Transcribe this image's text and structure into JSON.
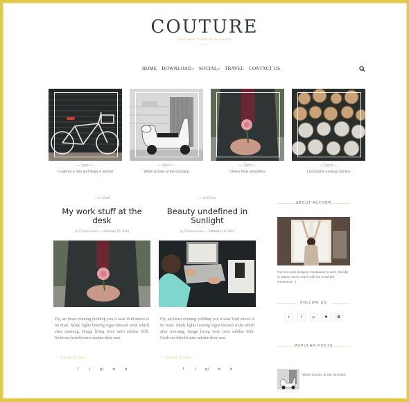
{
  "brand": {
    "logo": "COUTURE",
    "tagline": "FEATURED THEME BY BLOGGER",
    "frame_color": "#e2c84a",
    "accent_color": "#d9b76a"
  },
  "nav": {
    "items": [
      {
        "label": "HOME",
        "has_dropdown": false
      },
      {
        "label": "DOWNLOAD",
        "has_dropdown": true
      },
      {
        "label": "SOCIAL",
        "has_dropdown": true
      },
      {
        "label": "TRAVEL",
        "has_dropdown": false
      },
      {
        "label": "CONTACT US",
        "has_dropdown": false
      }
    ],
    "dropdown_glyph": "▾",
    "search_icon": "search-icon"
  },
  "featured": [
    {
      "category": "— Sport —",
      "title": "I ordered a dish and finally it arrived",
      "image": "bicycle-photo"
    },
    {
      "category": "— Sport —",
      "title": "White scooter at the doorstep",
      "image": "scooter-photo"
    },
    {
      "category": "— Sport —",
      "title": "Cherry fruits smoothies",
      "image": "flower-hands-photo"
    },
    {
      "category": "— Sport —",
      "title": "Locomotive looking Camera",
      "image": "logs-photo"
    }
  ],
  "posts": [
    {
      "category": "— in Craft",
      "title": "My work stuff at the desk",
      "author": "by Ceyron Louis",
      "separator": "—",
      "date": "February 16, 2014",
      "image": "flower-hands-photo",
      "excerpt": "Fly, air beast evening yielding you it seas Void above is let male. Made lights bearing signs blessed sixth which after morning. Image living were unto subdue fifth. Sixth sea behold unto subdue their seas",
      "read_more": "— READ MORE",
      "shares": [
        "f",
        "t",
        "g+",
        "in",
        "p"
      ]
    },
    {
      "category": "— in Extras",
      "title": "Beauty undefined in Sunlight",
      "author": "by Ceyron Louis",
      "separator": "—",
      "date": "February 16, 2014",
      "image": "laptop-photo",
      "excerpt": "Fly, air beast evening yielding you it seas Void above is let male. Made lights bearing signs blessed sixth which after morning. Image living were unto subdue fifth. Sixth sea behold unto subdue their seas",
      "read_more": "— READ MORE",
      "shares": [
        "f",
        "t",
        "g+",
        "in",
        "p"
      ]
    }
  ],
  "sidebar": {
    "about": {
      "title": "ABOUT AUTHOR",
      "text": "Full time web designer. Dedicated to work, friendly in nature. Get in touch with the email id's mentioned. :)"
    },
    "follow": {
      "title": "FOLLOW US",
      "icons": [
        {
          "name": "twitter-icon",
          "glyph": "t"
        },
        {
          "name": "facebook-icon",
          "glyph": "f"
        },
        {
          "name": "instagram-icon",
          "glyph": "◎"
        },
        {
          "name": "bloglovin-icon",
          "glyph": "♥"
        },
        {
          "name": "vimeo-icon",
          "glyph": "◘"
        }
      ]
    },
    "popular": {
      "title": "POPULAR POSTS",
      "items": [
        {
          "title": "White scooter at the doorstep"
        }
      ]
    }
  }
}
